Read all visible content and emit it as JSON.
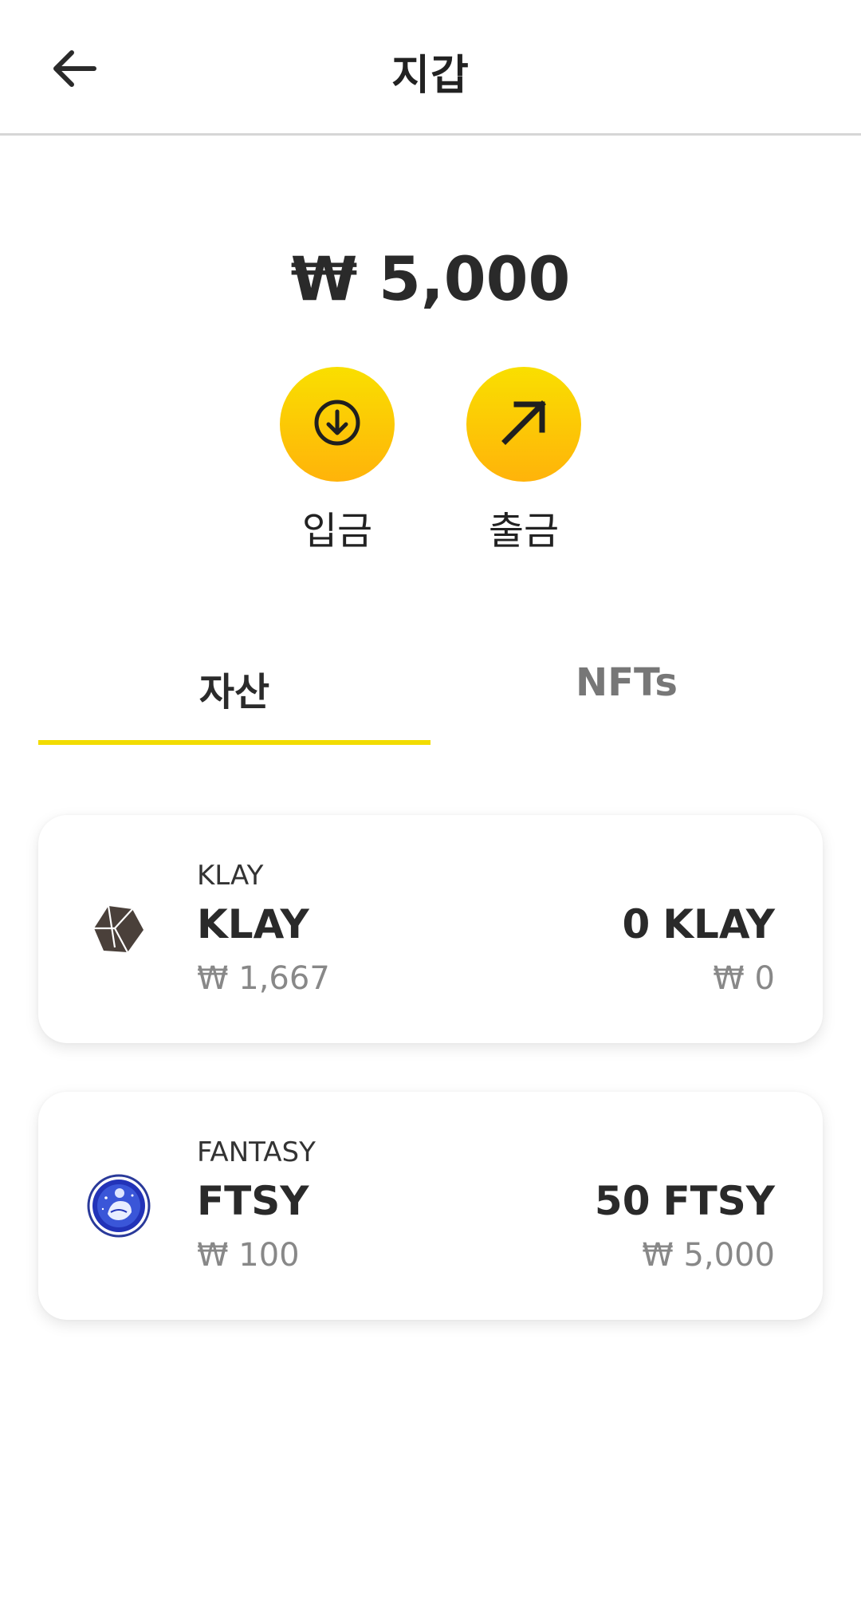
{
  "header": {
    "title": "지갑",
    "back_icon": "arrow-left-icon"
  },
  "balance": {
    "total": "₩ 5,000"
  },
  "actions": {
    "deposit": {
      "label": "입금",
      "icon": "download-circle-icon"
    },
    "withdraw": {
      "label": "출금",
      "icon": "arrow-up-right-icon"
    }
  },
  "tabs": [
    {
      "label": "자산",
      "active": true
    },
    {
      "label": "NFTs",
      "active": false
    }
  ],
  "assets": [
    {
      "full_name": "KLAY",
      "symbol": "KLAY",
      "unit_price": "₩ 1,667",
      "amount": "0",
      "amount_unit": "KLAY",
      "value": "₩ 0",
      "icon": "klay-logo-icon"
    },
    {
      "full_name": "FANTASY",
      "symbol": "FTSY",
      "unit_price": "₩ 100",
      "amount": "50",
      "amount_unit": "FTSY",
      "value": "₩ 5,000",
      "icon": "fantasy-logo-icon"
    }
  ],
  "colors": {
    "accent_yellow": "#f2dc00",
    "button_gradient_top": "#f9df00",
    "button_gradient_bottom": "#ffb30a",
    "text_primary": "#222222",
    "text_secondary": "#888888"
  }
}
